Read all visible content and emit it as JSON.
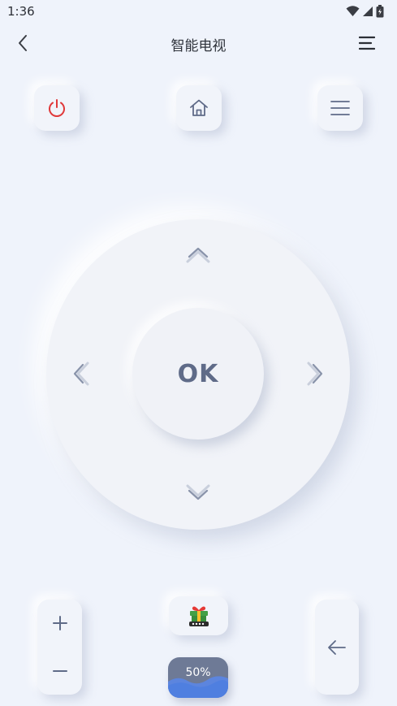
{
  "status": {
    "time": "1:36"
  },
  "header": {
    "title": "智能电视"
  },
  "remote": {
    "ok_label": "OK",
    "volume_progress": {
      "label": "50%",
      "value": 50
    }
  },
  "colors": {
    "background": "#eff3fb",
    "power_red": "#e0393a",
    "icon_gray": "#5f6b88",
    "badge_bg": "#6e7a96",
    "wave_blue": "#4f7fe0"
  },
  "icons": {
    "status": [
      "wifi-icon",
      "signal-icon",
      "battery-icon"
    ],
    "top_row": [
      "power-icon",
      "home-icon",
      "menu-icon"
    ],
    "dpad": [
      "arrow-up-icon",
      "arrow-left-icon",
      "arrow-right-icon",
      "arrow-down-icon"
    ],
    "bottom": [
      "plus-icon",
      "minus-icon",
      "gift-icon",
      "back-arrow-icon"
    ]
  }
}
